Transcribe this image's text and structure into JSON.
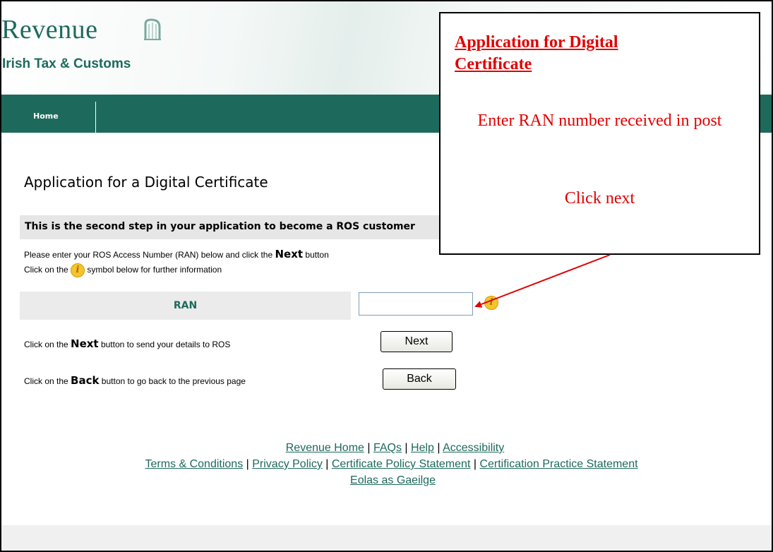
{
  "header": {
    "logo_title": "Revenue",
    "logo_subtitle": "Irish Tax & Customs"
  },
  "nav": {
    "home_label": "Home"
  },
  "main": {
    "page_title": "Application for a Digital Certificate",
    "step_text": "This is the second step in your application to become a ROS customer",
    "instruction_1_prefix": "Please enter your ROS Access Number (RAN) below and click the ",
    "instruction_1_bold": "Next",
    "instruction_1_suffix": " button",
    "instruction_2_prefix": "Click on the ",
    "instruction_2_suffix": " symbol below for further information",
    "ran_label": "RAN",
    "ran_value": "",
    "next_prefix": "Click on the ",
    "next_bold": "Next",
    "next_suffix": " button to send your details to ROS",
    "next_button": "Next",
    "back_prefix": "Click on the ",
    "back_bold": "Back",
    "back_suffix": " button to go back to the previous page",
    "back_button": "Back",
    "info_glyph": "i"
  },
  "footer": {
    "row1": [
      "Revenue Home",
      "FAQs",
      "Help",
      "Accessibility"
    ],
    "row2": [
      "Terms & Conditions",
      "Privacy Policy",
      "Certificate Policy Statement",
      "Certification Practice Statement"
    ],
    "row3": [
      "Eolas as Gaeilge"
    ],
    "separator": " | "
  },
  "callout": {
    "title": "Application for Digital Certificate",
    "line1": "Enter RAN number received in post",
    "line2": "Click next",
    "color": "#e00000"
  },
  "colors": {
    "brand": "#1d6a5c",
    "info": "#f4c430"
  },
  "icons": {
    "harp": "harp-icon",
    "info": "info-icon"
  }
}
